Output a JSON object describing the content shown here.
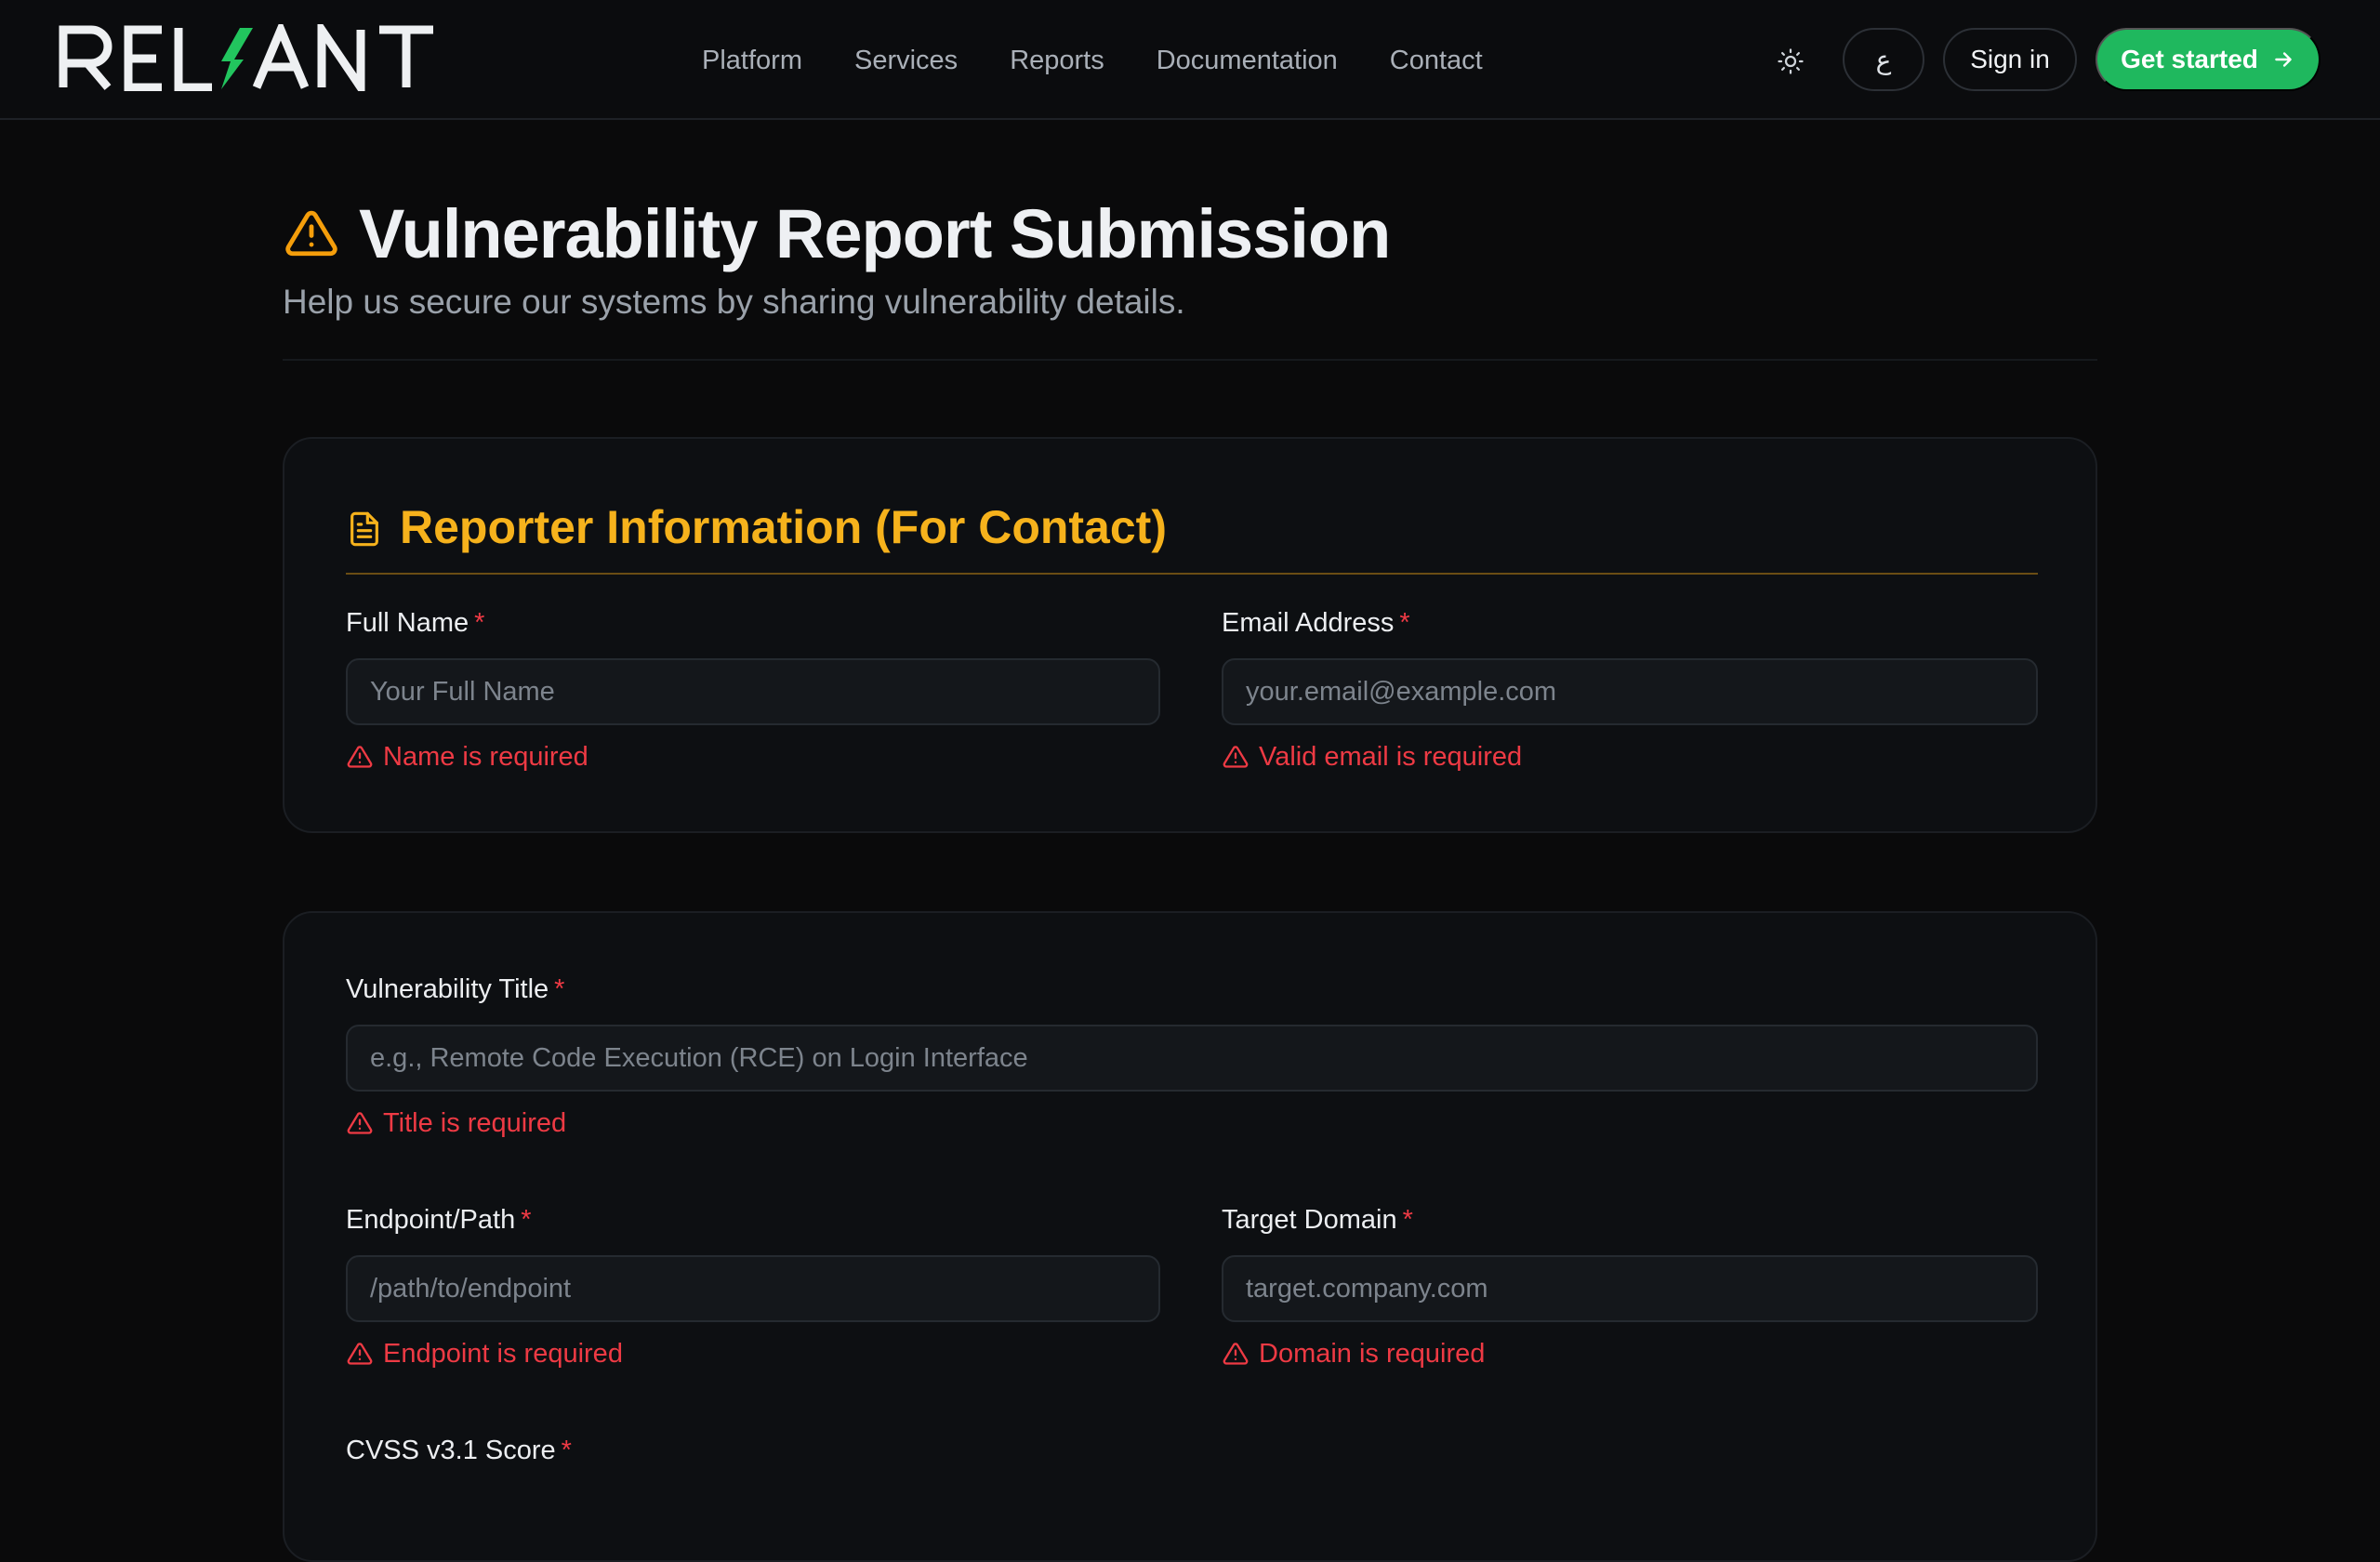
{
  "brand": {
    "name": "RELIANT",
    "accent": "#22c55e"
  },
  "nav": {
    "links": [
      "Platform",
      "Services",
      "Reports",
      "Documentation",
      "Contact"
    ],
    "theme_icon": "sun-icon",
    "lang_label": "ع",
    "signin_label": "Sign in",
    "start_label": "Get started",
    "start_icon": "arrow-right-icon"
  },
  "header": {
    "icon": "warning-triangle-icon",
    "title": "Vulnerability Report Submission",
    "subtitle": "Help us secure our systems by sharing vulnerability details."
  },
  "reporter": {
    "icon": "document-icon",
    "title": "Reporter Information (For Contact)",
    "full_name": {
      "label": "Full Name",
      "required_mark": "*",
      "value": "",
      "placeholder": "Your Full Name",
      "error": "Name is required"
    },
    "email": {
      "label": "Email Address",
      "required_mark": "*",
      "value": "",
      "placeholder": "your.email@example.com",
      "error": "Valid email is required"
    }
  },
  "vulnerability": {
    "title_field": {
      "label": "Vulnerability Title",
      "required_mark": "*",
      "value": "",
      "placeholder": "e.g., Remote Code Execution (RCE) on Login Interface",
      "error": "Title is required"
    },
    "endpoint": {
      "label": "Endpoint/Path",
      "required_mark": "*",
      "value": "",
      "placeholder": "/path/to/endpoint",
      "error": "Endpoint is required"
    },
    "domain": {
      "label": "Target Domain",
      "required_mark": "*",
      "value": "",
      "placeholder": "target.company.com",
      "error": "Domain is required"
    },
    "cvss": {
      "label": "CVSS v3.1 Score",
      "required_mark": "*"
    }
  },
  "colors": {
    "accent_amber": "#f6b21c",
    "error_red": "#ee3a44",
    "button_green": "#1fb85e"
  }
}
